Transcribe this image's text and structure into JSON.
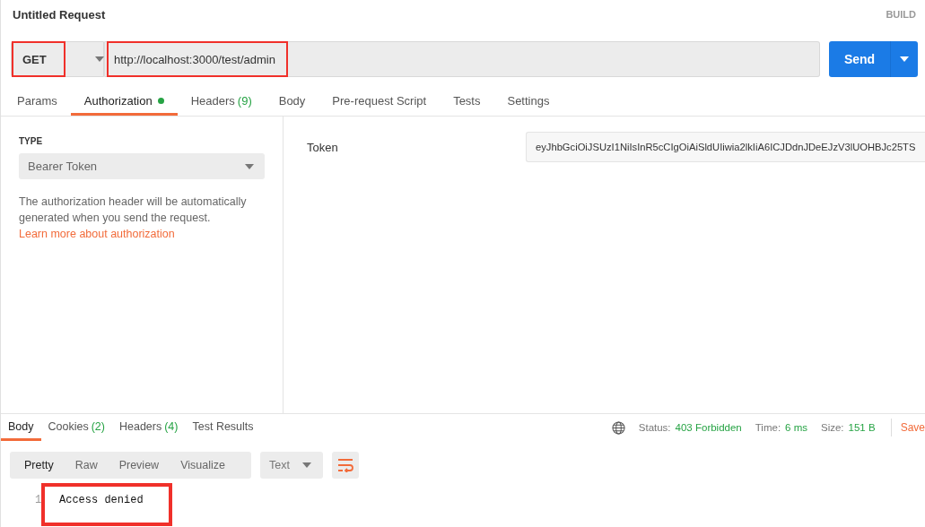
{
  "title": "Untitled Request",
  "mode_label": "BUILD",
  "request": {
    "method": "GET",
    "method_highlighted": true,
    "url": "http://localhost:3000/test/admin",
    "url_highlighted": true,
    "send": "Send"
  },
  "tabs": [
    {
      "label": "Params",
      "selected": false
    },
    {
      "label": "Authorization",
      "selected": true,
      "color": "#26a344"
    },
    {
      "label": "Headers",
      "count": "(9)",
      "selected": false
    },
    {
      "label": "Body",
      "selected": false
    },
    {
      "label": "Pre-request Script",
      "selected": false
    },
    {
      "label": "Tests",
      "selected": false
    },
    {
      "label": "Settings",
      "selected": false
    }
  ],
  "auth": {
    "type_label": "TYPE",
    "type_value": "Bearer Token",
    "help": "The authorization header will be automatically generated when you send the request.",
    "help_link": "Learn more about authorization",
    "token_label": "Token",
    "token_value": "eyJhbGciOiJSUzI1NiIsInR5cCIgOiAiSldUIiwia2lkIiA6ICJDdnJDeEJzV3lUOHBJc25TS"
  },
  "response_tabs": [
    {
      "label": "Body",
      "selected": true
    },
    {
      "label": "Cookies",
      "count": "(2)",
      "selected": false
    },
    {
      "label": "Headers",
      "count": "(4)",
      "selected": false
    },
    {
      "label": "Test Results",
      "selected": false
    }
  ],
  "status": [
    {
      "label": "Status:",
      "value": "403 Forbidden"
    },
    {
      "label": "Time:",
      "value": "6 ms"
    },
    {
      "label": "Size:",
      "value": "151 B"
    }
  ],
  "save": "Save",
  "view_modes": [
    {
      "label": "Pretty",
      "selected": true
    },
    {
      "label": "Raw",
      "selected": false
    },
    {
      "label": "Preview",
      "selected": false
    },
    {
      "label": "Visualize",
      "selected": false
    }
  ],
  "format": "Text",
  "body_lines": [
    {
      "number": "1",
      "text": "Access denied",
      "highlighted": true
    }
  ]
}
